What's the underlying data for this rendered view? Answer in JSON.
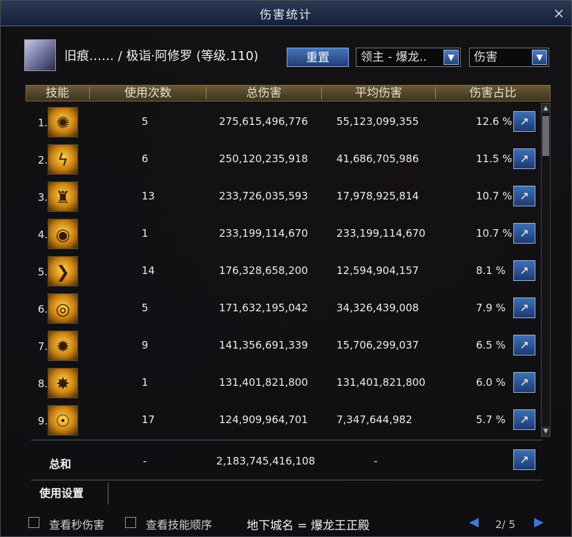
{
  "window": {
    "title": "伤害统计",
    "close_symbol": "×"
  },
  "character": {
    "name": "旧痕…… / 极诣·阿修罗 (等级.110)"
  },
  "controls": {
    "reset_label": "重置",
    "target_value": "领主 - 爆龙..",
    "metric_value": "伤害",
    "dropdown_arrow": "▼"
  },
  "table": {
    "headers": [
      "技能",
      "使用次数",
      "总伤害",
      "平均伤害",
      "伤害占比"
    ],
    "rows": [
      {
        "rank": "1.",
        "icon": "swirl-skill-icon",
        "glyph": "✺",
        "uses": "5",
        "total": "275,615,496,776",
        "avg": "55,123,099,355",
        "pct": "12.6 %"
      },
      {
        "rank": "2.",
        "icon": "lightning-skill-icon",
        "glyph": "ϟ",
        "uses": "6",
        "total": "250,120,235,918",
        "avg": "41,686,705,986",
        "pct": "11.5 %"
      },
      {
        "rank": "3.",
        "icon": "figure-skill-icon",
        "glyph": "♜",
        "uses": "13",
        "total": "233,726,035,593",
        "avg": "17,978,925,814",
        "pct": "10.7 %"
      },
      {
        "rank": "4.",
        "icon": "eye-skill-icon",
        "glyph": "◉",
        "uses": "1",
        "total": "233,199,114,670",
        "avg": "233,199,114,670",
        "pct": "10.7 %"
      },
      {
        "rank": "5.",
        "icon": "wave-skill-icon",
        "glyph": "❯",
        "uses": "14",
        "total": "176,328,658,200",
        "avg": "12,594,904,157",
        "pct": "8.1 %"
      },
      {
        "rank": "6.",
        "icon": "vortex-skill-icon",
        "glyph": "◎",
        "uses": "5",
        "total": "171,632,195,042",
        "avg": "34,326,439,008",
        "pct": "7.9 %"
      },
      {
        "rank": "7.",
        "icon": "burst-skill-icon",
        "glyph": "✹",
        "uses": "9",
        "total": "141,356,691,339",
        "avg": "15,706,299,037",
        "pct": "6.5 %"
      },
      {
        "rank": "8.",
        "icon": "flame-skill-icon",
        "glyph": "✸",
        "uses": "1",
        "total": "131,401,821,800",
        "avg": "131,401,821,800",
        "pct": "6.0 %"
      },
      {
        "rank": "9.",
        "icon": "face-skill-icon",
        "glyph": "☉",
        "uses": "17",
        "total": "124,909,964,701",
        "avg": "7,347,644,982",
        "pct": "5.7 %"
      }
    ],
    "total": {
      "label": "总和",
      "uses": "-",
      "total": "2,183,745,416,108",
      "avg": "-"
    }
  },
  "share_icon_glyph": "↗",
  "usage_settings_label": "使用设置",
  "options": {
    "per_second_label": "查看秒伤害",
    "skill_order_label": "查看技能顺序"
  },
  "dungeon": "地下城名 = 爆龙王正殿",
  "pagination": {
    "page": "2/ 5",
    "prev": "◀",
    "next": "▶"
  },
  "scroll": {
    "up": "▲",
    "down": "▼"
  }
}
